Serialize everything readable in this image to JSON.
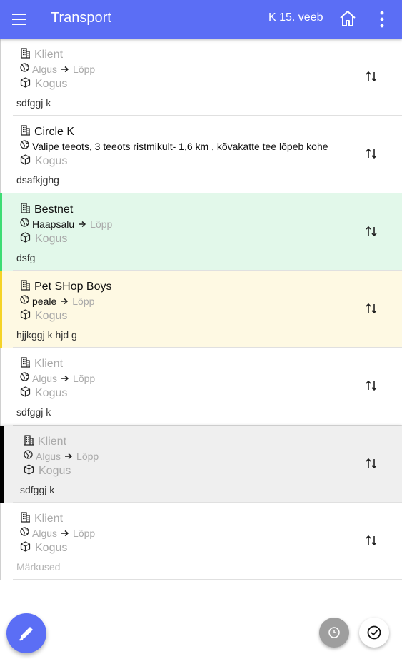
{
  "appbar": {
    "title": "Transport",
    "date": "K 15. veeb",
    "color": "#5b6ef5"
  },
  "orders": [
    {
      "client": "Klient",
      "client_filled": false,
      "start": "Algus",
      "start_filled": false,
      "end": "Lõpp",
      "quantity": "Kogus",
      "note": "sdfggj k",
      "note_filled": true,
      "bg": "#ffffff",
      "bar": "#d0d0d0"
    },
    {
      "client": "Circle K",
      "client_filled": true,
      "start": "Valipe teeots, 3 teeots ristmikult- 1,6 km , kõvakatte tee lõpeb kohe",
      "start_filled": true,
      "end": "",
      "quantity": "Kogus",
      "note": "dsafkjghg",
      "note_filled": true,
      "bg": "#ffffff",
      "bar": "#d0d0d0"
    },
    {
      "client": "Bestnet",
      "client_filled": true,
      "start": "Haapsalu",
      "start_filled": true,
      "end": "Lõpp",
      "quantity": "Kogus",
      "note": "dsfg",
      "note_filled": true,
      "bg": "#e2f8ea",
      "bar": "#3ddc74"
    },
    {
      "client": "Pet SHop Boys",
      "client_filled": true,
      "start": "peale",
      "start_filled": true,
      "end": "Lõpp",
      "quantity": "Kogus",
      "note": "hjjkggj k hjd g",
      "note_filled": true,
      "bg": "#fef9e3",
      "bar": "#f5d327"
    },
    {
      "client": "Klient",
      "client_filled": false,
      "start": "Algus",
      "start_filled": false,
      "end": "Lõpp",
      "quantity": "Kogus",
      "note": "sdfggj k",
      "note_filled": true,
      "bg": "#ffffff",
      "bar": "#d0d0d0"
    },
    {
      "client": "Klient",
      "client_filled": false,
      "start": "Algus",
      "start_filled": false,
      "end": "Lõpp",
      "quantity": "Kogus",
      "note": "sdfggj k",
      "note_filled": true,
      "bg": "#efefef",
      "bar": "#000000",
      "selected": true
    },
    {
      "client": "Klient",
      "client_filled": false,
      "start": "Algus",
      "start_filled": false,
      "end": "Lõpp",
      "quantity": "Kogus",
      "note": "Märkused",
      "note_filled": false,
      "bg": "#ffffff",
      "bar": "#d0d0d0"
    }
  ],
  "icons": {
    "menu": "menu-icon",
    "home": "home-icon",
    "more": "more-vert-icon",
    "client": "building-icon",
    "route": "globe-icon",
    "arrow": "arrow-right-icon",
    "quantity": "package-icon",
    "swap": "swap-vert-icon",
    "edit": "pencil-icon",
    "clock": "clock-icon",
    "check": "check-circle-icon"
  }
}
